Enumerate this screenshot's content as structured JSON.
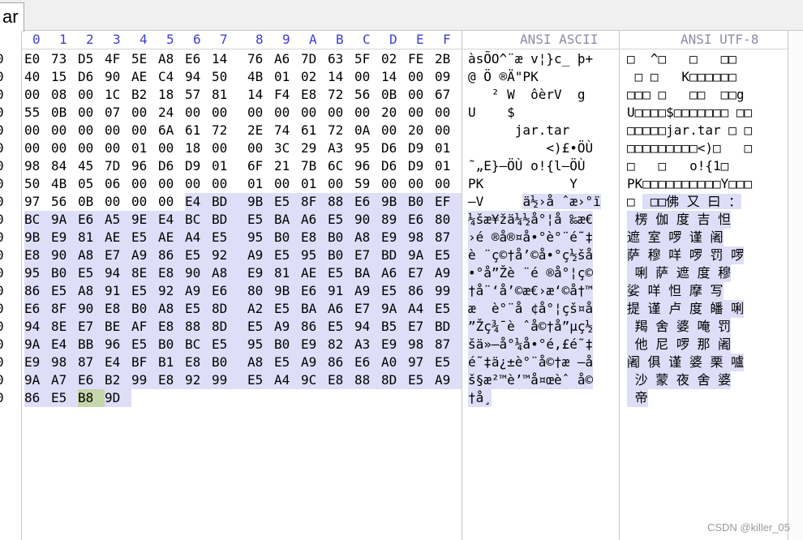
{
  "tab": {
    "label": "ar"
  },
  "header": {
    "columns": [
      "0",
      "1",
      "2",
      "3",
      "4",
      "5",
      "6",
      "7",
      "8",
      "9",
      "A",
      "B",
      "C",
      "D",
      "E",
      "F"
    ],
    "ansi_label": "ANSI ASCII",
    "utf8_label": "ANSI UTF-8"
  },
  "gutter_char": "0",
  "hex_rows": [
    [
      "E0",
      "73",
      "D5",
      "4F",
      "5E",
      "A8",
      "E6",
      "14",
      "76",
      "A6",
      "7D",
      "63",
      "5F",
      "02",
      "FE",
      "2B"
    ],
    [
      "40",
      "15",
      "D6",
      "90",
      "AE",
      "C4",
      "94",
      "50",
      "4B",
      "01",
      "02",
      "14",
      "00",
      "14",
      "00",
      "09"
    ],
    [
      "00",
      "08",
      "00",
      "1C",
      "B2",
      "18",
      "57",
      "81",
      "14",
      "F4",
      "E8",
      "72",
      "56",
      "0B",
      "00",
      "67"
    ],
    [
      "55",
      "0B",
      "00",
      "07",
      "00",
      "24",
      "00",
      "00",
      "00",
      "00",
      "00",
      "00",
      "00",
      "20",
      "00",
      "00"
    ],
    [
      "00",
      "00",
      "00",
      "00",
      "00",
      "6A",
      "61",
      "72",
      "2E",
      "74",
      "61",
      "72",
      "0A",
      "00",
      "20",
      "00"
    ],
    [
      "00",
      "00",
      "00",
      "00",
      "01",
      "00",
      "18",
      "00",
      "00",
      "3C",
      "29",
      "A3",
      "95",
      "D6",
      "D9",
      "01"
    ],
    [
      "98",
      "84",
      "45",
      "7D",
      "96",
      "D6",
      "D9",
      "01",
      "6F",
      "21",
      "7B",
      "6C",
      "96",
      "D6",
      "D9",
      "01"
    ],
    [
      "50",
      "4B",
      "05",
      "06",
      "00",
      "00",
      "00",
      "00",
      "01",
      "00",
      "01",
      "00",
      "59",
      "00",
      "00",
      "00"
    ],
    [
      "97",
      "56",
      "0B",
      "00",
      "00",
      "00",
      "E4",
      "BD",
      "9B",
      "E5",
      "8F",
      "88",
      "E6",
      "9B",
      "B0",
      "EF"
    ],
    [
      "BC",
      "9A",
      "E6",
      "A5",
      "9E",
      "E4",
      "BC",
      "BD",
      "E5",
      "BA",
      "A6",
      "E5",
      "90",
      "89",
      "E6",
      "80"
    ],
    [
      "9B",
      "E9",
      "81",
      "AE",
      "E5",
      "AE",
      "A4",
      "E5",
      "95",
      "B0",
      "E8",
      "B0",
      "A8",
      "E9",
      "98",
      "87"
    ],
    [
      "E8",
      "90",
      "A8",
      "E7",
      "A9",
      "86",
      "E5",
      "92",
      "A9",
      "E5",
      "95",
      "B0",
      "E7",
      "BD",
      "9A",
      "E5"
    ],
    [
      "95",
      "B0",
      "E5",
      "94",
      "8E",
      "E8",
      "90",
      "A8",
      "E9",
      "81",
      "AE",
      "E5",
      "BA",
      "A6",
      "E7",
      "A9"
    ],
    [
      "86",
      "E5",
      "A8",
      "91",
      "E5",
      "92",
      "A9",
      "E6",
      "80",
      "9B",
      "E6",
      "91",
      "A9",
      "E5",
      "86",
      "99"
    ],
    [
      "E6",
      "8F",
      "90",
      "E8",
      "B0",
      "A8",
      "E5",
      "8D",
      "A2",
      "E5",
      "BA",
      "A6",
      "E7",
      "9A",
      "A4",
      "E5"
    ],
    [
      "94",
      "8E",
      "E7",
      "BE",
      "AF",
      "E8",
      "88",
      "8D",
      "E5",
      "A9",
      "86",
      "E5",
      "94",
      "B5",
      "E7",
      "BD"
    ],
    [
      "9A",
      "E4",
      "BB",
      "96",
      "E5",
      "B0",
      "BC",
      "E5",
      "95",
      "B0",
      "E9",
      "82",
      "A3",
      "E9",
      "98",
      "87"
    ],
    [
      "E9",
      "98",
      "87",
      "E4",
      "BF",
      "B1",
      "E8",
      "B0",
      "A8",
      "E5",
      "A9",
      "86",
      "E6",
      "A0",
      "97",
      "E5"
    ],
    [
      "9A",
      "A7",
      "E6",
      "B2",
      "99",
      "E8",
      "92",
      "99",
      "E5",
      "A4",
      "9C",
      "E8",
      "88",
      "8D",
      "E5",
      "A9"
    ],
    [
      "86",
      "E5",
      "B8",
      "9D"
    ]
  ],
  "ansi_rows": [
    "àsÕO^¨æ v¦}c_ þ+",
    "@ Ö ®Ä\"PK",
    "   ² W  ôèrV  g",
    "U    $",
    "      jar.tar",
    "          <)£•ÖÙ",
    "˜„E}–ÖÙ o!{l–ÖÙ",
    "PK           Y",
    "—V     ä½›å ˆæ›°ï",
    "¼šæ¥žä¼½å°¦å ‰æ€",
    "›é ®å®¤å•°è°¨é˜‡",
    "è ¨ç©†å’©å•°ç½šå",
    "•°å”Žè ¨é ®å°¦ç©",
    "†å¨‘å’©æ€›æ‘©å†™",
    "æ  è°¨å ¢å°¦çš¤å",
    "”Žç¾¯è ˆå©†å”µç½",
    "šä»–å°¼å•°é‚£é˜‡",
    "é˜‡ä¿±è°¨å©†æ —å",
    "š§æ²™è’™å¤œèˆ å©",
    "†å¸"
  ],
  "utf8_rows": [
    "□  ^□   □   □□",
    " □ □   K□□□□□□",
    "□□□ □   □□  □□g",
    "U□□□□$□□□□□□□ □□",
    "□□□□□jar.tar □ □",
    "□□□□□□□□□<)□   □",
    "□   □   o!{1□",
    "PK□□□□□□□□□□Y□□□",
    "□  □□佛 又 曰 ：",
    " 楞 伽 度 吉 怛",
    "遮 室 啰 谨 阇",
    "萨 穆 咩 啰 罚 啰",
    " 唎 萨 遮 度 穆",
    "娑 咩 怛 摩 写",
    "提 谨 卢 度 皤 唎",
    " 羯 舍 婆 唵 罚",
    " 他 尼 啰 那 阇",
    "阇 俱 谨 婆 栗 嚧",
    " 沙 蒙 夜 舍 婆",
    " 帝"
  ],
  "watermark": "CSDN @killer_05"
}
